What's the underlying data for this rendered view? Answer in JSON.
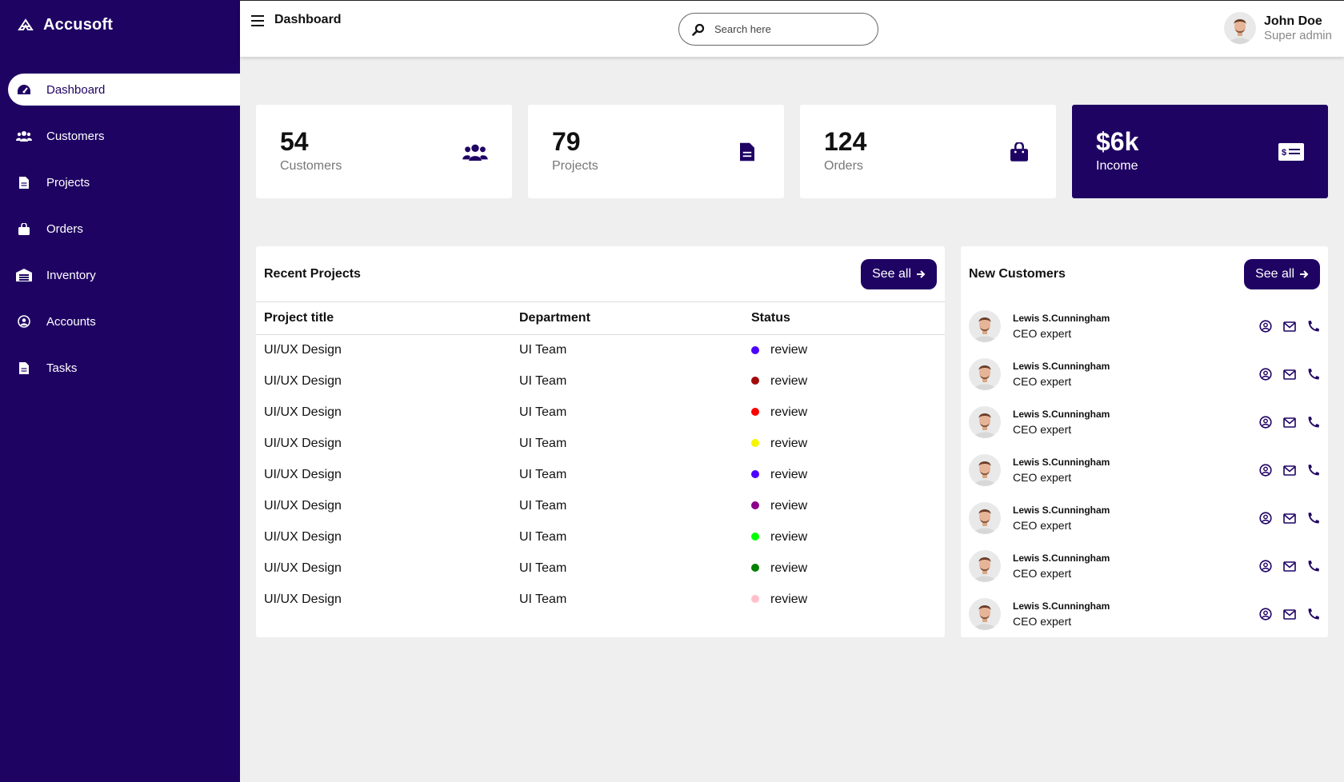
{
  "brand": {
    "name": "Accusoft"
  },
  "sidebar": {
    "items": [
      {
        "label": "Dashboard",
        "icon": "gauge-icon",
        "active": true
      },
      {
        "label": "Customers",
        "icon": "users-icon"
      },
      {
        "label": "Projects",
        "icon": "file-icon"
      },
      {
        "label": "Orders",
        "icon": "bag-icon"
      },
      {
        "label": "Inventory",
        "icon": "warehouse-icon"
      },
      {
        "label": "Accounts",
        "icon": "user-circle-icon"
      },
      {
        "label": "Tasks",
        "icon": "file-icon"
      }
    ]
  },
  "header": {
    "title": "Dashboard",
    "search_placeholder": "Search here",
    "user": {
      "name": "John Doe",
      "role": "Super admin"
    }
  },
  "cards": [
    {
      "value": "54",
      "label": "Customers",
      "icon": "users-icon"
    },
    {
      "value": "79",
      "label": "Projects",
      "icon": "file-icon"
    },
    {
      "value": "124",
      "label": "Orders",
      "icon": "bag-icon"
    },
    {
      "value": "$6k",
      "label": "Income",
      "icon": "money-check-icon"
    }
  ],
  "recent_projects": {
    "title": "Recent Projects",
    "see_all": "See all",
    "columns": [
      "Project title",
      "Department",
      "Status"
    ],
    "rows": [
      {
        "title": "UI/UX Design",
        "department": "UI Team",
        "status": "review",
        "color": "#4b00ff"
      },
      {
        "title": "UI/UX Design",
        "department": "UI Team",
        "status": "review",
        "color": "#a30b0b"
      },
      {
        "title": "UI/UX Design",
        "department": "UI Team",
        "status": "review",
        "color": "#ff0000"
      },
      {
        "title": "UI/UX Design",
        "department": "UI Team",
        "status": "review",
        "color": "#f5f500"
      },
      {
        "title": "UI/UX Design",
        "department": "UI Team",
        "status": "review",
        "color": "#4b00ff"
      },
      {
        "title": "UI/UX Design",
        "department": "UI Team",
        "status": "review",
        "color": "#8b008b"
      },
      {
        "title": "UI/UX Design",
        "department": "UI Team",
        "status": "review",
        "color": "#00ff00"
      },
      {
        "title": "UI/UX Design",
        "department": "UI Team",
        "status": "review",
        "color": "#008000"
      },
      {
        "title": "UI/UX Design",
        "department": "UI Team",
        "status": "review",
        "color": "#ffc0cb"
      }
    ]
  },
  "new_customers": {
    "title": "New Customers",
    "see_all": "See all",
    "items": [
      {
        "name": "Lewis S.Cunningham",
        "role": "CEO expert"
      },
      {
        "name": "Lewis S.Cunningham",
        "role": "CEO expert"
      },
      {
        "name": "Lewis S.Cunningham",
        "role": "CEO expert"
      },
      {
        "name": "Lewis S.Cunningham",
        "role": "CEO expert"
      },
      {
        "name": "Lewis S.Cunningham",
        "role": "CEO expert"
      },
      {
        "name": "Lewis S.Cunningham",
        "role": "CEO expert"
      },
      {
        "name": "Lewis S.Cunningham",
        "role": "CEO expert"
      }
    ]
  },
  "colors": {
    "primary": "#1f0363",
    "background": "#efefef"
  }
}
